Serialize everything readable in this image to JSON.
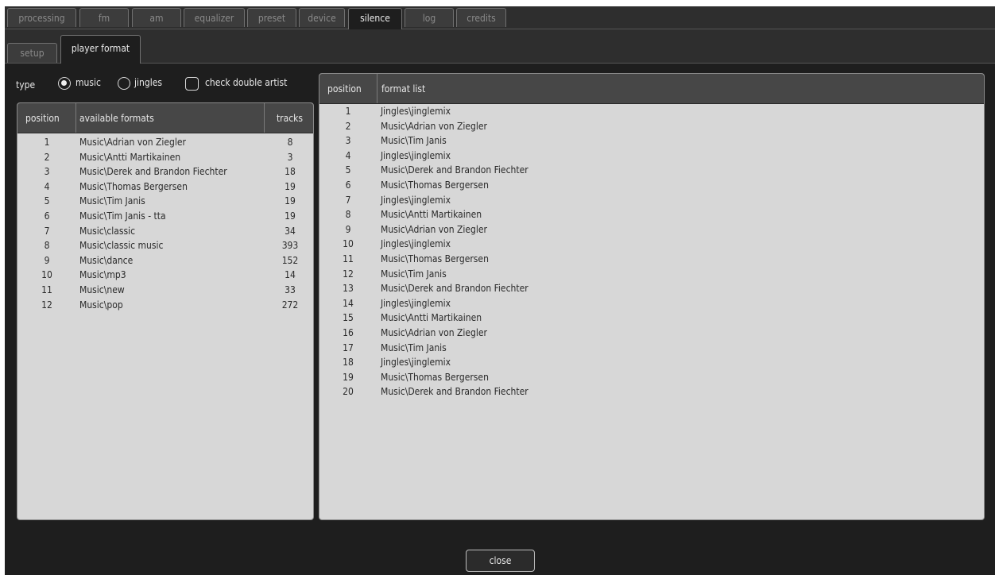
{
  "main_tabs": [
    "processing",
    "fm",
    "am",
    "equalizer",
    "preset",
    "device",
    "silence",
    "log",
    "credits"
  ],
  "sub_tabs": [
    "setup",
    "player format"
  ],
  "type_row": {
    "label": "type",
    "music_label": "music",
    "jingles_label": "jingles",
    "check_double_artist_label": "check double artist",
    "selected": "music"
  },
  "available_formats": {
    "headers": {
      "position": "position",
      "name": "available formats",
      "tracks": "tracks"
    },
    "rows": [
      {
        "position": "1",
        "name": "Music\\Adrian von Ziegler",
        "tracks": "8"
      },
      {
        "position": "2",
        "name": "Music\\Antti Martikainen",
        "tracks": "3"
      },
      {
        "position": "3",
        "name": "Music\\Derek and Brandon Fiechter",
        "tracks": "18"
      },
      {
        "position": "4",
        "name": "Music\\Thomas Bergersen",
        "tracks": "19"
      },
      {
        "position": "5",
        "name": "Music\\Tim Janis",
        "tracks": "19"
      },
      {
        "position": "6",
        "name": "Music\\Tim Janis - tta",
        "tracks": "19"
      },
      {
        "position": "7",
        "name": "Music\\classic",
        "tracks": "34"
      },
      {
        "position": "8",
        "name": "Music\\classic music",
        "tracks": "393"
      },
      {
        "position": "9",
        "name": "Music\\dance",
        "tracks": "152"
      },
      {
        "position": "10",
        "name": "Music\\mp3",
        "tracks": "14"
      },
      {
        "position": "11",
        "name": "Music\\new",
        "tracks": "33"
      },
      {
        "position": "12",
        "name": "Music\\pop",
        "tracks": "272"
      }
    ]
  },
  "format_list": {
    "headers": {
      "position": "position",
      "name": "format list"
    },
    "rows": [
      {
        "position": "1",
        "name": "Jingles\\jinglemix"
      },
      {
        "position": "2",
        "name": "Music\\Adrian von Ziegler"
      },
      {
        "position": "3",
        "name": "Music\\Tim Janis"
      },
      {
        "position": "4",
        "name": "Jingles\\jinglemix"
      },
      {
        "position": "5",
        "name": "Music\\Derek and Brandon Fiechter"
      },
      {
        "position": "6",
        "name": "Music\\Thomas Bergersen"
      },
      {
        "position": "7",
        "name": "Jingles\\jinglemix"
      },
      {
        "position": "8",
        "name": "Music\\Antti Martikainen"
      },
      {
        "position": "9",
        "name": "Music\\Adrian von Ziegler"
      },
      {
        "position": "10",
        "name": "Jingles\\jinglemix"
      },
      {
        "position": "11",
        "name": "Music\\Thomas Bergersen"
      },
      {
        "position": "12",
        "name": "Music\\Tim Janis"
      },
      {
        "position": "13",
        "name": "Music\\Derek and Brandon Fiechter"
      },
      {
        "position": "14",
        "name": "Jingles\\jinglemix"
      },
      {
        "position": "15",
        "name": "Music\\Antti Martikainen"
      },
      {
        "position": "16",
        "name": "Music\\Adrian von Ziegler"
      },
      {
        "position": "17",
        "name": "Music\\Tim Janis"
      },
      {
        "position": "18",
        "name": "Jingles\\jinglemix"
      },
      {
        "position": "19",
        "name": "Music\\Thomas Bergersen"
      },
      {
        "position": "20",
        "name": "Music\\Derek and Brandon Fiechter"
      }
    ]
  },
  "close_label": "close"
}
